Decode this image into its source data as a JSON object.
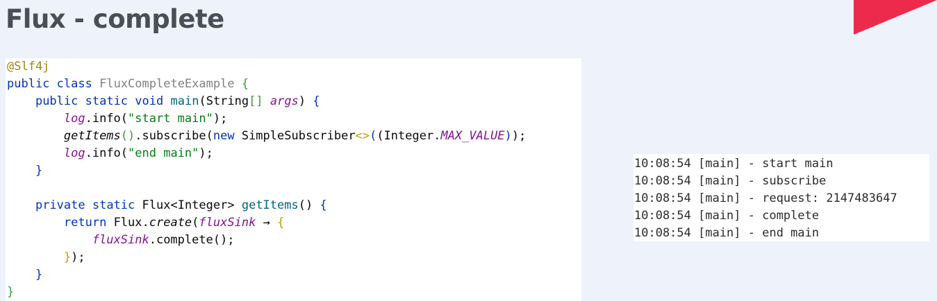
{
  "slide": {
    "title": "Flux - complete",
    "accent_color": "#ee2a4c"
  },
  "code": {
    "annotation": "@Slf4j",
    "kw_public": "public",
    "kw_class": "class",
    "class_name": "FluxCompleteExample",
    "kw_static": "static",
    "kw_void": "void",
    "main_method": "main",
    "string_type": "String",
    "args_param": "args",
    "log_field": "log",
    "info_call": ".info(",
    "start_str": "\"start main\"",
    "end_str": "\"end main\"",
    "get_items": "getItems",
    "subscribe_call": ".subscribe(",
    "kw_new": "new",
    "simple_subscriber": "SimpleSubscriber",
    "diamond": "<>",
    "integer_prefix": "(Integer.",
    "max_value": "MAX_VALUE",
    "kw_private": "private",
    "flux_integer_type": "Flux<Integer>",
    "get_items_method": "getItems",
    "kw_return": "return",
    "flux_prefix": "Flux.",
    "create_call": "create",
    "flux_sink": "fluxSink",
    "arrow": "→",
    "complete_call": ".complete();"
  },
  "console": {
    "lines": [
      "10:08:54 [main] - start main",
      "10:08:54 [main] - subscribe",
      "10:08:54 [main] - request: 2147483647",
      "10:08:54 [main] - complete",
      "10:08:54 [main] - end main"
    ]
  }
}
